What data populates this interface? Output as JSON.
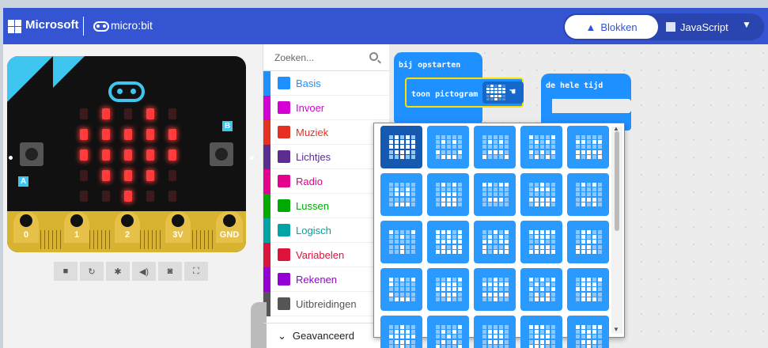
{
  "header": {
    "brand": "Microsoft",
    "product": "micro:bit",
    "tabs": {
      "blocks": "Blokken",
      "javascript": "JavaScript"
    }
  },
  "simulator": {
    "button_a": "A",
    "button_b": "B",
    "pins": [
      "0",
      "1",
      "2",
      "3V",
      "GND"
    ],
    "led_matrix": [
      [
        0,
        1,
        0,
        1,
        0
      ],
      [
        1,
        1,
        1,
        1,
        1
      ],
      [
        1,
        1,
        1,
        1,
        1
      ],
      [
        0,
        1,
        1,
        1,
        0
      ],
      [
        0,
        0,
        1,
        0,
        0
      ]
    ],
    "controls": [
      "stop-icon",
      "restart-icon",
      "debug-icon",
      "sound-icon",
      "screenshot-icon",
      "fullscreen-icon"
    ]
  },
  "toolbox": {
    "search_placeholder": "Zoeken...",
    "categories": [
      {
        "label": "Basis",
        "color": "#1e90ff",
        "icon": "grid-icon"
      },
      {
        "label": "Invoer",
        "color": "#d400d4",
        "icon": "target-icon"
      },
      {
        "label": "Muziek",
        "color": "#e63022",
        "icon": "headphones-icon"
      },
      {
        "label": "Lichtjes",
        "color": "#5c2d91",
        "icon": "toggle-icon"
      },
      {
        "label": "Radio",
        "color": "#e3008c",
        "icon": "signal-icon"
      },
      {
        "label": "Lussen",
        "color": "#00aa00",
        "icon": "loop-icon"
      },
      {
        "label": "Logisch",
        "color": "#00a4a6",
        "icon": "shuffle-icon"
      },
      {
        "label": "Variabelen",
        "color": "#dc143c",
        "icon": "list-icon"
      },
      {
        "label": "Rekenen",
        "color": "#9400d3",
        "icon": "calculator-icon"
      },
      {
        "label": "Uitbreidingen",
        "color": "#555555",
        "icon": "plus-circle-icon"
      }
    ],
    "advanced": "Geavanceerd"
  },
  "workspace": {
    "on_start": "bij opstarten",
    "show_icon": "toon pictogram",
    "forever": "de hele tijd"
  },
  "icon_picker": {
    "icons": [
      "0101011111111110111000100",
      "0000001010000001000101110",
      "0000001010000000111010001",
      "1000101010000001010101010",
      "0000011011000001111110101",
      "0000001010011100000001110",
      "0101000000011100111001110",
      "1101100000000000111000000",
      "0010001110000001111101110",
      "0101000000000000111001010",
      "1000100100000000010000100",
      "1110110101111110101111111",
      "0010101010110111000110111",
      "1111101110001000111011111",
      "0110001010011101110011110",
      "1010110000000001000001110",
      "0010101110111110111000100",
      "0010011111001001111100100",
      "1010101010101010101001110",
      "0110101110111100110001110",
      "0010001110111110111000100",
      "0000101010001000101010001",
      "0000001110011100111000000",
      "1110001010011100111011100",
      "1101101110001000111000100"
    ]
  }
}
